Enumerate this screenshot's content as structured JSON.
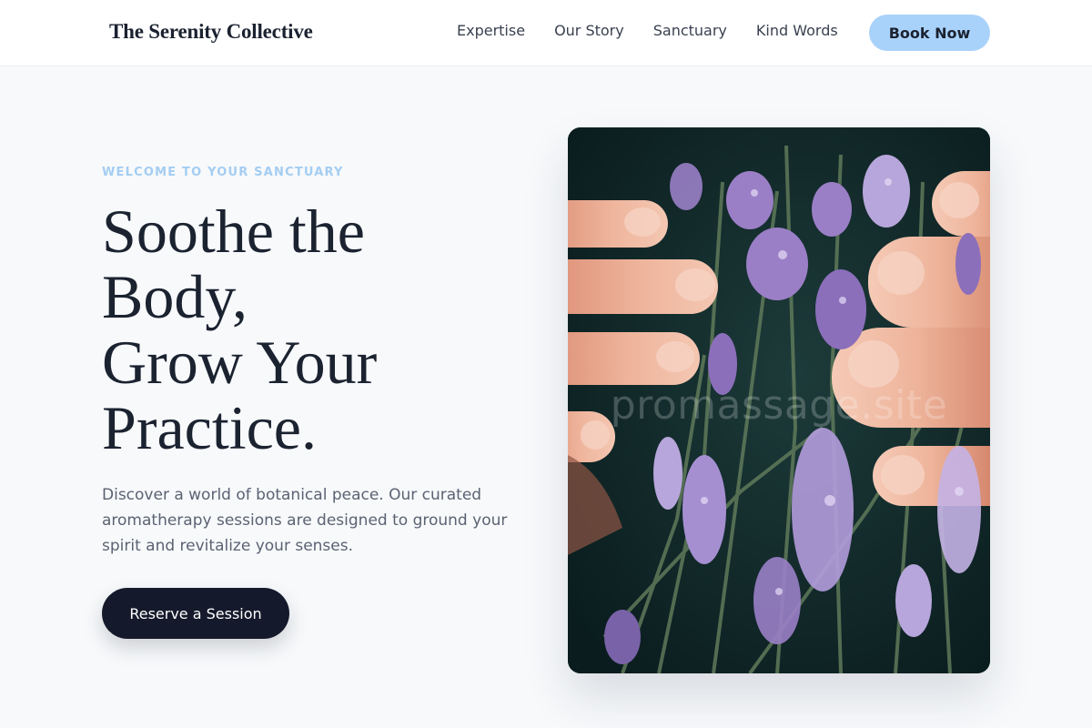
{
  "header": {
    "brand": "The Serenity Collective",
    "nav": [
      {
        "label": "Expertise"
      },
      {
        "label": "Our Story"
      },
      {
        "label": "Sanctuary"
      },
      {
        "label": "Kind Words"
      }
    ],
    "cta_label": "Book Now"
  },
  "hero": {
    "eyebrow": "WELCOME TO YOUR SANCTUARY",
    "headline_lines": [
      "Soothe the",
      "Body,",
      "Grow Your",
      "Practice."
    ],
    "description": "Discover a world of botanical peace. Our curated aromatherapy sessions are designed to ground your spirit and revitalize your senses.",
    "cta_label": "Reserve a Session",
    "image": {
      "subject": "hands-holding-lavender",
      "watermark": "promassage.site"
    }
  },
  "colors": {
    "page_background": "#f7f9fb",
    "accent_light_blue": "#a9d2fb",
    "eyebrow_blue": "#a4cdf2",
    "dark_navy": "#141a2b",
    "lavender": "#9a7fc6"
  }
}
